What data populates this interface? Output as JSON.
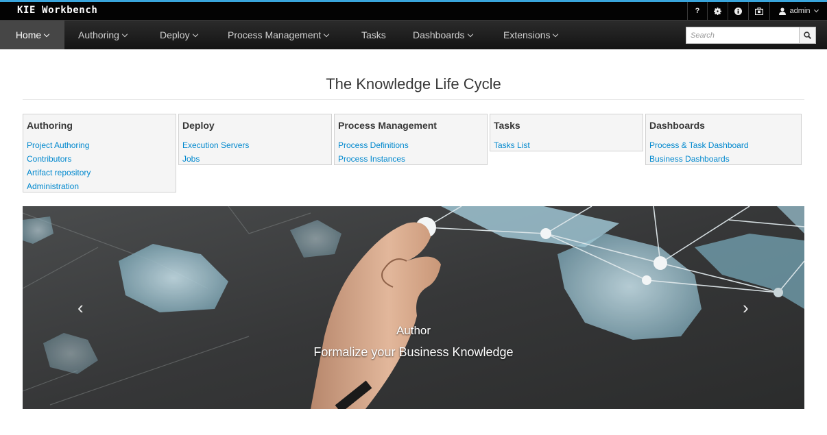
{
  "app": {
    "title": "KIE Workbench"
  },
  "topbar": {
    "help_icon": "question-icon",
    "settings_icon": "gear-icon",
    "info_icon": "info-icon",
    "tasks_icon": "briefcase-icon",
    "user_name": "admin"
  },
  "nav": {
    "items": [
      {
        "label": "Home",
        "has_caret": true,
        "active": true
      },
      {
        "label": "Authoring",
        "has_caret": true
      },
      {
        "label": "Deploy",
        "has_caret": true
      },
      {
        "label": "Process Management",
        "has_caret": true
      },
      {
        "label": "Tasks",
        "has_caret": false
      },
      {
        "label": "Dashboards",
        "has_caret": true
      },
      {
        "label": "Extensions",
        "has_caret": true
      }
    ],
    "search": {
      "placeholder": "Search"
    }
  },
  "page": {
    "title": "The Knowledge Life Cycle"
  },
  "cards": [
    {
      "title": "Authoring",
      "links": [
        "Project Authoring",
        "Contributors",
        "Artifact repository",
        "Administration"
      ]
    },
    {
      "title": "Deploy",
      "links": [
        "Execution Servers",
        "Jobs"
      ]
    },
    {
      "title": "Process Management",
      "links": [
        "Process Definitions",
        "Process Instances"
      ]
    },
    {
      "title": "Tasks",
      "links": [
        "Tasks List"
      ]
    },
    {
      "title": "Dashboards",
      "links": [
        "Process & Task Dashboard",
        "Business Dashboards"
      ]
    }
  ],
  "carousel": {
    "prev": "‹",
    "next": "›",
    "caption_title": "Author",
    "caption_text": "Formalize your Business Knowledge"
  },
  "colors": {
    "accent": "#39a5dc",
    "link": "#0088ce",
    "nav_bg": "#1d1d1d"
  }
}
